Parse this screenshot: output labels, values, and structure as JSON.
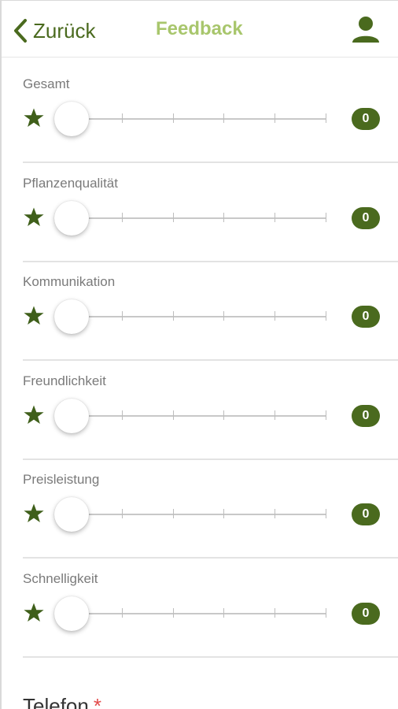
{
  "header": {
    "back_label": "Zurück",
    "title": "Feedback",
    "colors": {
      "primary": "#4a6a1e",
      "title": "#a8c66c"
    }
  },
  "ratings": [
    {
      "label": "Gesamt",
      "value": "0"
    },
    {
      "label": "Pflanzenqualität",
      "value": "0"
    },
    {
      "label": "Kommunikation",
      "value": "0"
    },
    {
      "label": "Freundlichkeit",
      "value": "0"
    },
    {
      "label": "Preisleistung",
      "value": "0"
    },
    {
      "label": "Schnelligkeit",
      "value": "0"
    }
  ],
  "phone": {
    "label": "Telefon",
    "required_mark": "*"
  }
}
